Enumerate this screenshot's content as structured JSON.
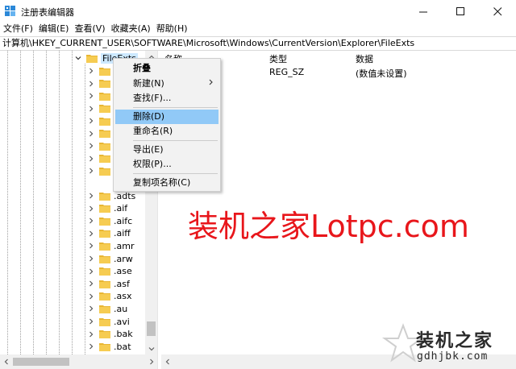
{
  "window": {
    "title": "注册表编辑器",
    "icon": "regedit-icon"
  },
  "menu": [
    "文件(F)",
    "编辑(E)",
    "查看(V)",
    "收藏夹(A)",
    "帮助(H)"
  ],
  "address": "计算机\\HKEY_CURRENT_USER\\SOFTWARE\\Microsoft\\Windows\\CurrentVersion\\Explorer\\FileExts",
  "tree": {
    "expanded_key": "FileExts",
    "children": [
      ".adts",
      ".aif",
      ".aifc",
      ".aiff",
      ".amr",
      ".arw",
      ".ase",
      ".asf",
      ".asx",
      ".au",
      ".avi",
      ".bak",
      ".bat"
    ]
  },
  "list": {
    "headers": {
      "name": "名称",
      "type": "类型",
      "data": "数据"
    },
    "rows": [
      {
        "type": "REG_SZ",
        "data": "(数值未设置)"
      }
    ]
  },
  "context_menu": {
    "items": [
      {
        "label": "折叠",
        "bold": true
      },
      {
        "label": "新建(N)",
        "submenu": true
      },
      {
        "label": "查找(F)..."
      },
      {
        "label": "删除(D)",
        "highlighted": true
      },
      {
        "label": "重命名(R)"
      },
      {
        "label": "导出(E)"
      },
      {
        "label": "权限(P)..."
      },
      {
        "label": "复制项名称(C)"
      }
    ]
  },
  "watermark": {
    "main": "装机之家Lotpc.com",
    "logo_cn": "装机之家",
    "logo_url": "gdhjbk.com",
    "color": "#e8161b"
  }
}
